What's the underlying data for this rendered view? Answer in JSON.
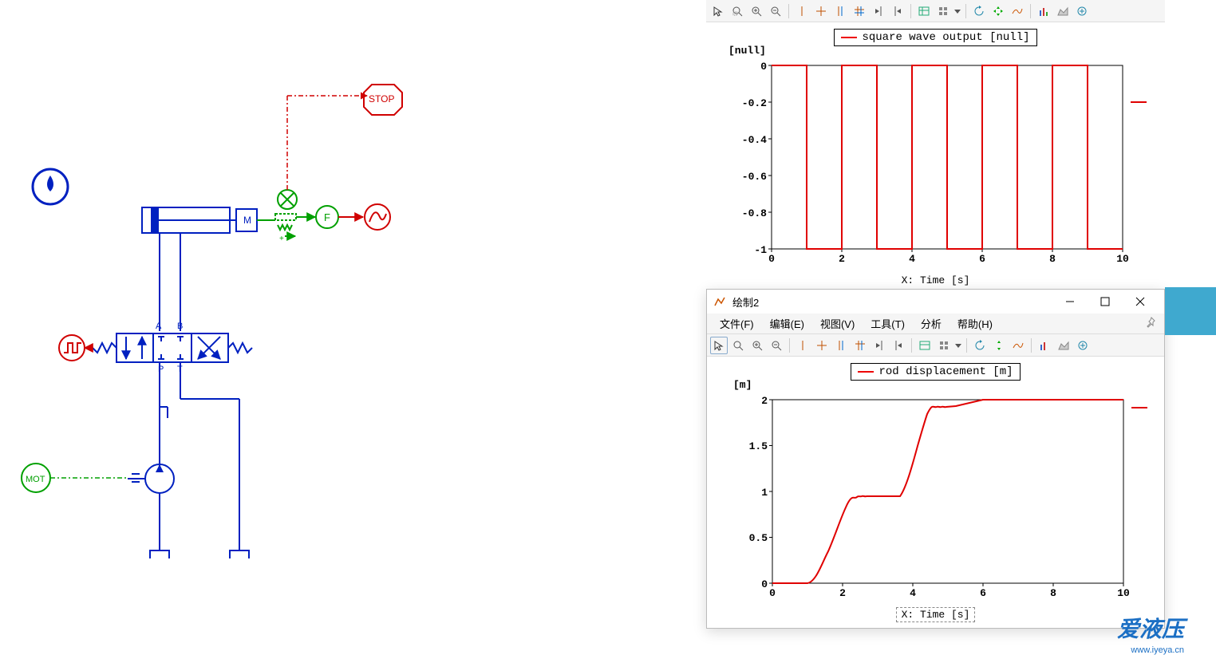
{
  "diagram": {
    "stop_label": "STOP",
    "mass_label": "M",
    "motor_label": "MOT",
    "force_label": "F",
    "port_a": "A",
    "port_b": "B",
    "port_p": "P",
    "port_t": "T"
  },
  "toolbar1": {
    "icons": [
      "cursor",
      "zoom-area",
      "zoom-in",
      "zoom-out",
      "vline",
      "crosshair",
      "dual-vline",
      "dual-crosshair",
      "scan-left",
      "scan-right",
      "table",
      "grid",
      "dropdown",
      "refresh",
      "pan",
      "smooth",
      "bar-chart",
      "area-chart",
      "add-plot"
    ]
  },
  "plot2": {
    "window_title": "绘制2",
    "menu": {
      "file": "文件(F)",
      "edit": "编辑(E)",
      "view": "视图(V)",
      "tools": "工具(T)",
      "analysis": "分析",
      "help": "帮助(H)"
    }
  },
  "chart_data": [
    {
      "type": "line",
      "title": "",
      "legend": [
        "square wave output [null]"
      ],
      "y_unit": "[null]",
      "xlabel": "X: Time [s]",
      "x": [
        0,
        1,
        1,
        2,
        2,
        3,
        3,
        4,
        4,
        5,
        5,
        6,
        6,
        7,
        7,
        8,
        8,
        9,
        9,
        10
      ],
      "series": [
        {
          "name": "square wave output [null]",
          "values": [
            0,
            0,
            -1,
            -1,
            0,
            0,
            -1,
            -1,
            0,
            0,
            -1,
            -1,
            0,
            0,
            -1,
            -1,
            0,
            0,
            -1,
            -1
          ]
        }
      ],
      "xlim": [
        0,
        10
      ],
      "ylim": [
        -1.0,
        0.0
      ],
      "xticks": [
        0,
        2,
        4,
        6,
        8,
        10
      ],
      "yticks": [
        0.0,
        -0.2,
        -0.4,
        -0.6,
        -0.8,
        -1.0
      ]
    },
    {
      "type": "line",
      "title": "",
      "legend": [
        "rod displacement [m]"
      ],
      "y_unit": "[m]",
      "xlabel": "X: Time [s]",
      "x": [
        0,
        1,
        1.5,
        2,
        2.2,
        2.4,
        2.6,
        2.8,
        3,
        3.5,
        4,
        4.2,
        4.4,
        4.6,
        4.8,
        5,
        6,
        8,
        10
      ],
      "series": [
        {
          "name": "rod displacement [m]",
          "values": [
            0,
            0,
            0.25,
            0.55,
            0.78,
            0.88,
            0.92,
            0.94,
            0.95,
            0.95,
            0.95,
            1.35,
            1.7,
            1.85,
            1.93,
            1.95,
            2.0,
            2.0,
            2.0
          ]
        }
      ],
      "xlim": [
        0,
        10
      ],
      "ylim": [
        0.0,
        2.0
      ],
      "xticks": [
        0,
        2,
        4,
        6,
        8,
        10
      ],
      "yticks": [
        0.0,
        0.5,
        1.0,
        1.5,
        2.0
      ]
    }
  ],
  "watermark": {
    "main": "爱液压",
    "sub": "www.iyeya.cn"
  }
}
